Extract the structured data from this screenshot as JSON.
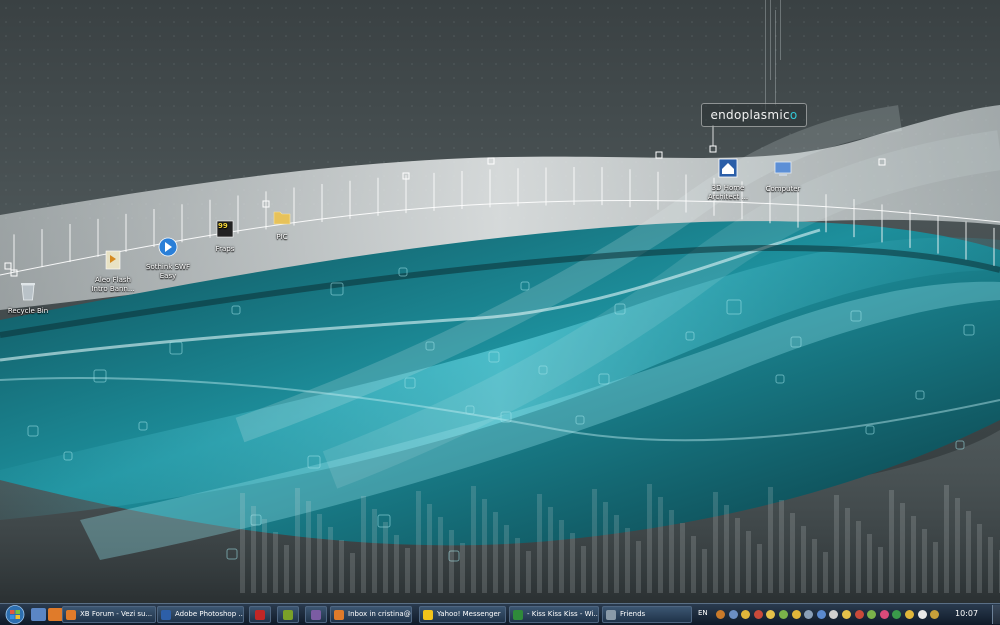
{
  "desktop": {
    "brand": {
      "text": "endoplasmic",
      "accent": "o"
    },
    "icons": [
      {
        "name": "recycle-bin-icon",
        "label": "Recycle Bin",
        "color": "#b9c2c8"
      },
      {
        "name": "aleo-flash-icon",
        "label": "Aleo Flash\nIntro Bann...",
        "color": "#e8e2c4"
      },
      {
        "name": "sothink-swf-icon",
        "label": "Sothink SWF\nEasy",
        "color": "#2a7fd8"
      },
      {
        "name": "fraps-icon",
        "label": "Fraps",
        "color": "#f2d43a",
        "badge": "99"
      },
      {
        "name": "folder-icon",
        "label": "PIC",
        "color": "#e7c25a"
      },
      {
        "name": "3d-home-architect-icon",
        "label": "3D Home\nArchitect ...",
        "color": "#2a5ea8"
      },
      {
        "name": "computer-icon",
        "label": "Computer",
        "color": "#5c8fd6"
      }
    ]
  },
  "taskbar": {
    "quicklaunch": [
      {
        "name": "quicklaunch-show-desktop-icon",
        "color": "#5b86c4"
      },
      {
        "name": "quicklaunch-firefox-icon",
        "color": "#e07b2a"
      }
    ],
    "tasks": [
      {
        "name": "task-xb-forum",
        "label": "XB Forum - Vezi su...",
        "color": "#e07b2a"
      },
      {
        "name": "task-photoshop",
        "label": "Adobe Photoshop ...",
        "color": "#2d5fa8"
      },
      {
        "name": "task-app-red",
        "label": "",
        "color": "#c02626"
      },
      {
        "name": "task-dreamweaver",
        "label": "",
        "color": "#7aa128"
      },
      {
        "name": "task-illustrator",
        "label": "",
        "color": "#7b5ca3"
      },
      {
        "name": "task-inbox",
        "label": "Inbox in cristina@i...",
        "color": "#e07b2a"
      },
      {
        "name": "task-yahoo",
        "label": "Yahoo! Messenger",
        "color": "#f2c41a"
      },
      {
        "name": "task-kiss",
        "label": "- Kiss Kiss Kiss - Wi...",
        "color": "#2f8a3a"
      },
      {
        "name": "task-friends",
        "label": "Friends",
        "color": "#8a9aa8"
      }
    ],
    "language": "EN",
    "tray_colors": [
      "#c97a2a",
      "#6b8fc4",
      "#e0b63a",
      "#c94a3a",
      "#e5c24a",
      "#7ab24a",
      "#e0b63a",
      "#8aa0b8",
      "#5a8ad0",
      "#d0d0d0",
      "#e5c24a",
      "#c94a3a",
      "#7ab24a",
      "#d94a7a",
      "#3a9a4a",
      "#e0b63a",
      "#e8e8e8",
      "#c8a03a"
    ],
    "clock": "10:07"
  }
}
